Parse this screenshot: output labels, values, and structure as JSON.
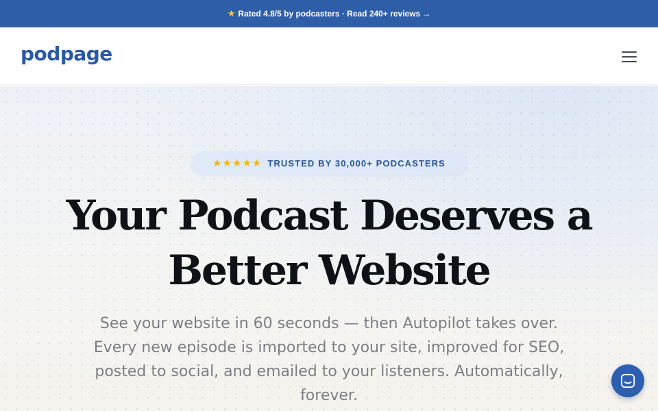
{
  "banner": {
    "star_icon": "star-icon",
    "text": "Rated 4.8/5 by podcasters · Read 240+ reviews",
    "arrow": "→",
    "background": "#2f5ea8"
  },
  "header": {
    "logo": "podpage",
    "logo_color": "#2a5aa6",
    "menu_icon": "hamburger-menu-icon"
  },
  "hero": {
    "trust_stars": "★★★★★",
    "trust_text": "TRUSTED BY 30,000+ PODCASTERS",
    "headline_line1": "Your Podcast Deserves a",
    "headline_line2": "Better Website",
    "subtext": "See your website in 60 seconds — then Autopilot takes over. Every new episode is imported to your site, improved for SEO, posted to social, and emailed to your listeners. Automatically, forever."
  },
  "chat": {
    "icon": "chat-icon",
    "color": "#2d5fb0"
  }
}
